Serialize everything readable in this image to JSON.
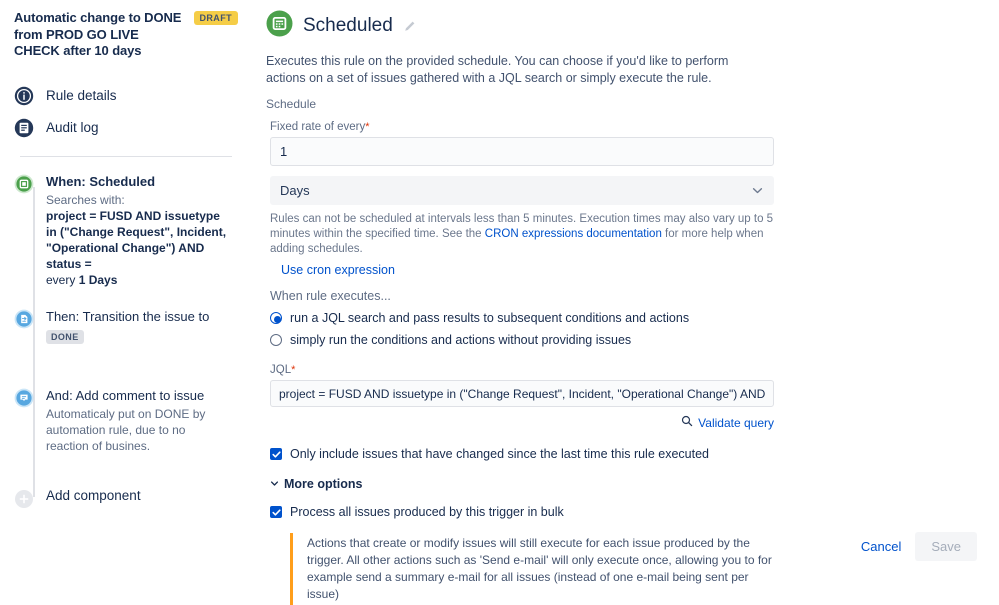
{
  "rule": {
    "title": "Automatic change to DONE from PROD GO LIVE CHECK after 10 days",
    "status_badge": "DRAFT",
    "badge_color": "#F5CD47"
  },
  "sidebar": {
    "nav": [
      {
        "label": "Rule details",
        "icon": "info-circle-icon"
      },
      {
        "label": "Audit log",
        "icon": "document-list-icon"
      }
    ],
    "timeline": [
      {
        "title": "When: Scheduled",
        "subtitle": "Searches with:",
        "jql": "project = FUSD AND issuetype in (\"Change Request\", Incident, \"Operational Change\") AND status =",
        "every_prefix": "every ",
        "every_value": "1 Days",
        "icon": "calendar-icon",
        "color": "#4BA04B"
      },
      {
        "title": "Then: Transition the issue to",
        "badge": "DONE",
        "icon": "transition-icon",
        "color": "#57A7E0"
      },
      {
        "title": "And: Add comment to issue",
        "description": "Automaticaly put on DONE by automation rule, due to no reaction of busines.",
        "icon": "comment-icon",
        "color": "#57A7E0"
      }
    ],
    "add_component": {
      "label": "Add component",
      "icon": "plus-circle-icon"
    }
  },
  "panel": {
    "icon": "calendar-icon",
    "title": "Scheduled",
    "edit_icon": "pencil-icon",
    "description": "Executes this rule on the provided schedule. You can choose if you'd like to perform actions on a set of issues gathered with a JQL search or simply execute the rule.",
    "schedule_label": "Schedule",
    "fixed_rate": {
      "label": "Fixed rate of every",
      "required": "*",
      "value": "1"
    },
    "unit_select": {
      "value": "Days",
      "icon": "chevron-down-icon"
    },
    "helper_before": "Rules can not be scheduled at intervals less than 5 minutes. Execution times may also vary up to 5 minutes within the specified time. See the ",
    "helper_link": "CRON expressions documentation",
    "helper_after": " for more help when adding schedules.",
    "cron_link": "Use cron expression",
    "when_executes_label": "When rule executes...",
    "radios": [
      {
        "label": "run a JQL search and pass results to subsequent conditions and actions",
        "checked": true
      },
      {
        "label": "simply run the conditions and actions without providing issues",
        "checked": false
      }
    ],
    "jql": {
      "label": "JQL",
      "required": "*",
      "value": "project = FUSD AND issuetype in (\"Change Request\", Incident, \"Operational Change\") AND status = \"Proc"
    },
    "validate_query": {
      "label": "Validate query",
      "icon": "search-icon"
    },
    "checkbox_changed": {
      "label": "Only include issues that have changed since the last time this rule executed",
      "checked": true
    },
    "more_options": {
      "label": "More options",
      "icon": "chevron-down-icon"
    },
    "checkbox_bulk": {
      "label": "Process all issues produced by this trigger in bulk",
      "checked": true
    },
    "info_box": {
      "text": "Actions that create or modify issues will still execute for each issue produced by the trigger. All other actions such as 'Send e-mail' will only execute once, allowing you to for example send a summary e-mail for all issues (instead of one e-mail being sent per issue)",
      "accent": "#FF9E1B"
    },
    "footer": {
      "cancel": "Cancel",
      "save": "Save"
    }
  }
}
